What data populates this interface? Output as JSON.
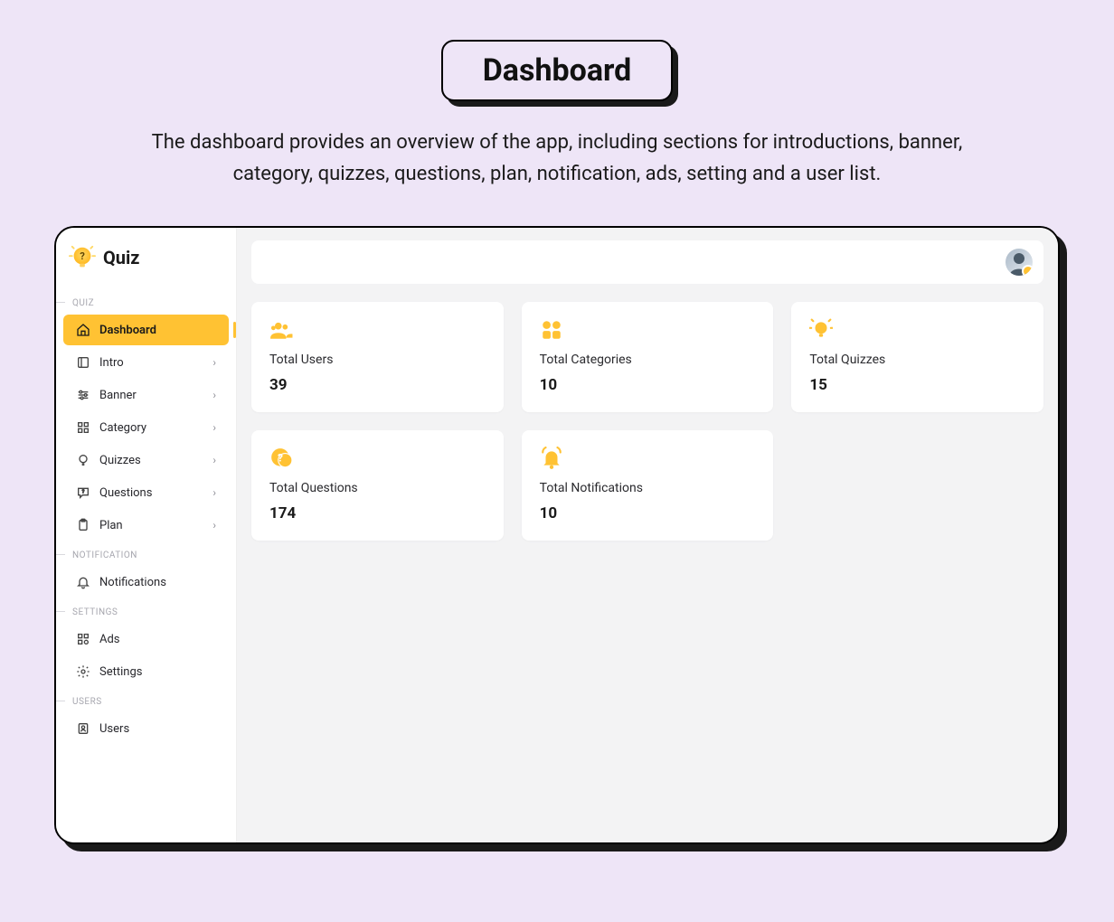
{
  "page": {
    "title": "Dashboard",
    "subtitle": "The dashboard provides an overview of the app, including sections for introductions, banner, category, quizzes, questions, plan, notification, ads, setting and a user list."
  },
  "brand": {
    "name": "Quiz"
  },
  "sidebar": {
    "sections": {
      "quiz": {
        "label": "QUIZ"
      },
      "notification": {
        "label": "NOTIFICATION"
      },
      "settings": {
        "label": "SETTINGS"
      },
      "users": {
        "label": "USERS"
      }
    },
    "items": {
      "dashboard": "Dashboard",
      "intro": "Intro",
      "banner": "Banner",
      "category": "Category",
      "quizzes": "Quizzes",
      "questions": "Questions",
      "plan": "Plan",
      "notifications": "Notifications",
      "ads": "Ads",
      "settings": "Settings",
      "users": "Users"
    }
  },
  "cards": {
    "users": {
      "label": "Total Users",
      "value": "39"
    },
    "categories": {
      "label": "Total Categories",
      "value": "10"
    },
    "quizzes": {
      "label": "Total Quizzes",
      "value": "15"
    },
    "questions": {
      "label": "Total Questions",
      "value": "174"
    },
    "notifications": {
      "label": "Total Notifications",
      "value": "10"
    }
  }
}
